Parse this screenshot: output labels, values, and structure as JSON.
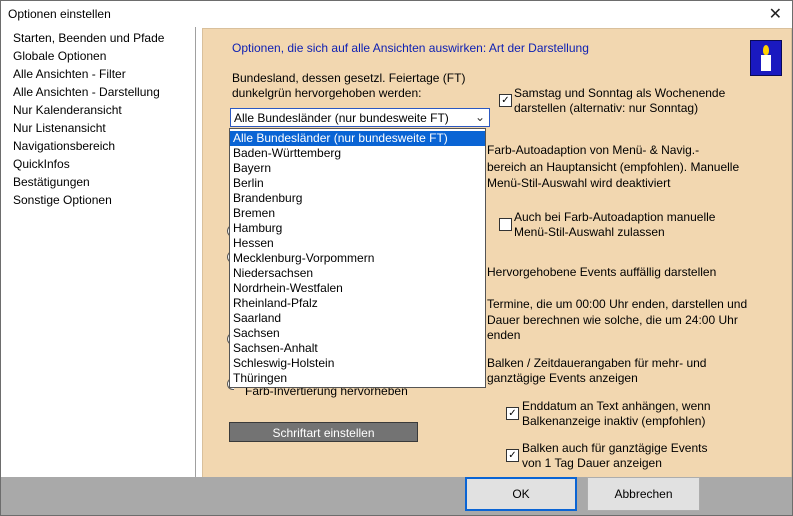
{
  "window": {
    "title": "Optionen einstellen",
    "close_symbol": "✕"
  },
  "nav": {
    "items": [
      "Starten, Beenden und Pfade",
      "Globale Optionen",
      "Alle Ansichten - Filter",
      "Alle Ansichten - Darstellung",
      "Nur Kalenderansicht",
      "Nur Listenansicht",
      "Navigationsbereich",
      "QuickInfos",
      "Bestätigungen",
      "Sonstige Optionen"
    ]
  },
  "panel": {
    "heading": "Optionen, die sich auf alle Ansichten auswirken: Art der Darstellung",
    "holiday_label_1": "Bundesland, dessen gesetzl. Feiertage (FT)",
    "holiday_label_2": "dunkelgrün hervorgehoben werden:",
    "combo_value": "Alle Bundesländer (nur bundesweite FT)",
    "dropdown_options": [
      "Alle Bundesländer (nur bundesweite FT)",
      "Baden-Württemberg",
      "Bayern",
      "Berlin",
      "Brandenburg",
      "Bremen",
      "Hamburg",
      "Hessen",
      "Mecklenburg-Vorpommern",
      "Niedersachsen",
      "Nordrhein-Westfalen",
      "Rheinland-Pfalz",
      "Saarland",
      "Sachsen",
      "Sachsen-Anhalt",
      "Schleswig-Holstein",
      "Thüringen"
    ],
    "partial_hidden_label": "Farb-Invertierung hervorheben",
    "font_button": "Schriftart einstellen",
    "opt_weekend_1": "Samstag und Sonntag als Wochenende",
    "opt_weekend_2": "darstellen (alternativ: nur Sonntag)",
    "opt_autoadapt_1": "Farb-Autoadaption von Menü- & Navig.-",
    "opt_autoadapt_2": "bereich an Hauptansicht (empfohlen). Manuelle",
    "opt_autoadapt_3": "Menü-Stil-Auswahl wird deaktiviert",
    "opt_manual_1": "Auch bei Farb-Autoadaption manuelle",
    "opt_manual_2": "Menü-Stil-Auswahl zulassen",
    "opt_highlight": "Hervorgehobene Events auffällig darstellen",
    "opt_midnight_1": "Termine, die um 00:00 Uhr enden, darstellen und",
    "opt_midnight_2": "Dauer berechnen wie solche, die um 24:00 Uhr",
    "opt_midnight_3": "enden",
    "opt_bars_1": "Balken / Zeitdauerangaben für mehr- und",
    "opt_bars_2": "ganztägige Events anzeigen",
    "opt_enddate_1": "Enddatum an Text anhängen, wenn",
    "opt_enddate_2": "Balkenanzeige inaktiv (empfohlen)",
    "opt_fullday_1": "Balken auch für ganztägige Events",
    "opt_fullday_2": "von 1 Tag Dauer anzeigen",
    "check_mark": "✓"
  },
  "buttons": {
    "ok": "OK",
    "cancel": "Abbrechen"
  },
  "colors": {
    "panel_bg": "#f2d7b0",
    "heading": "#0d1fb3",
    "selection": "#0a64d4",
    "footer": "#a9a9a9"
  }
}
